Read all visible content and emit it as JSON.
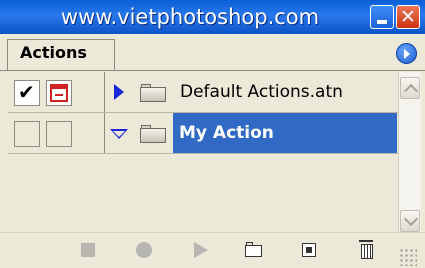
{
  "window": {
    "title": "www.vietphotoshop.com"
  },
  "panel": {
    "tab_label": "Actions"
  },
  "rows": [
    {
      "label": "Default Actions.atn",
      "checked": true,
      "dialog_icon": true,
      "expanded": false,
      "selected": false
    },
    {
      "label": "My Action",
      "checked": false,
      "dialog_icon": false,
      "expanded": true,
      "selected": true
    }
  ],
  "colors": {
    "titlebar": "#0a5fd6",
    "selection": "#316ac5",
    "panel_bg": "#ece9d8",
    "expand_triangle": "#1a27d8"
  },
  "toolbar_icons": [
    "stop-icon",
    "record-icon",
    "play-icon",
    "new-set-icon",
    "new-action-icon",
    "trash-icon"
  ]
}
